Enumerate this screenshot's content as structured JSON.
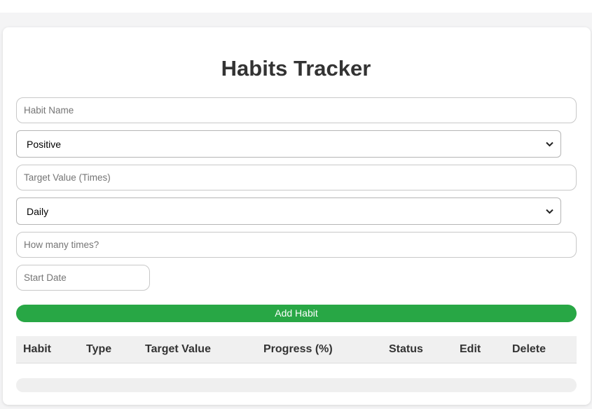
{
  "title": "Habits Tracker",
  "form": {
    "habit_name_placeholder": "Habit Name",
    "type_select_value": "Positive",
    "target_value_placeholder": "Target Value (Times)",
    "frequency_select_value": "Daily",
    "times_placeholder": "How many times?",
    "start_date_placeholder": "Start Date",
    "add_button_label": "Add Habit"
  },
  "table": {
    "columns": [
      "Habit",
      "Type",
      "Target Value",
      "Progress (%)",
      "Status",
      "Edit",
      "Delete"
    ]
  },
  "colors": {
    "accent": "#28a745"
  }
}
